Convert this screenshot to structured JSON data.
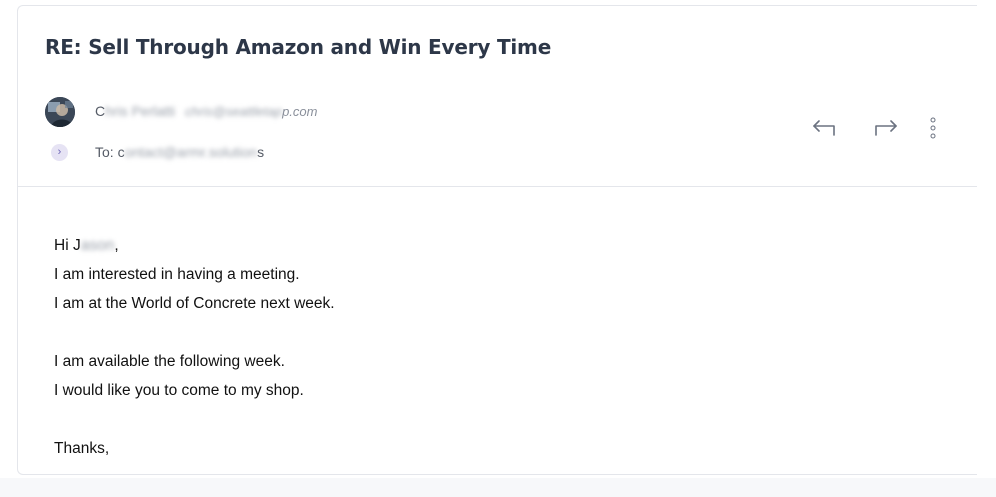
{
  "email": {
    "subject": "RE: Sell Through Amazon and Win Every Time",
    "sender": {
      "name_visible_start": "C",
      "name_obscured": "hris Perlatti",
      "email_obscured": "chris@seattletap",
      "email_visible_end": "p.com"
    },
    "recipient": {
      "prefix": "To: c",
      "obscured": "ontact@armr.solution",
      "visible_end": "s"
    },
    "actions": {
      "reply_icon": "reply-arrow-icon",
      "forward_icon": "forward-arrow-icon",
      "more_icon": "vertical-dots-icon"
    },
    "body": {
      "greeting_start": "Hi J",
      "greeting_obscured": "ason",
      "greeting_end": ",",
      "lines_block1": [
        "I am interested in having a meeting.",
        "I am at the World of Concrete next week."
      ],
      "lines_block2": [
        "I am available the following week.",
        "I would like you to come to my shop."
      ],
      "signoff": "Thanks,"
    }
  },
  "colors": {
    "subject": "#2d3748",
    "expand_bg": "#e6e3f4",
    "expand_fg": "#6c63b5",
    "icon": "#6b7280",
    "border": "#e4e6eb"
  }
}
